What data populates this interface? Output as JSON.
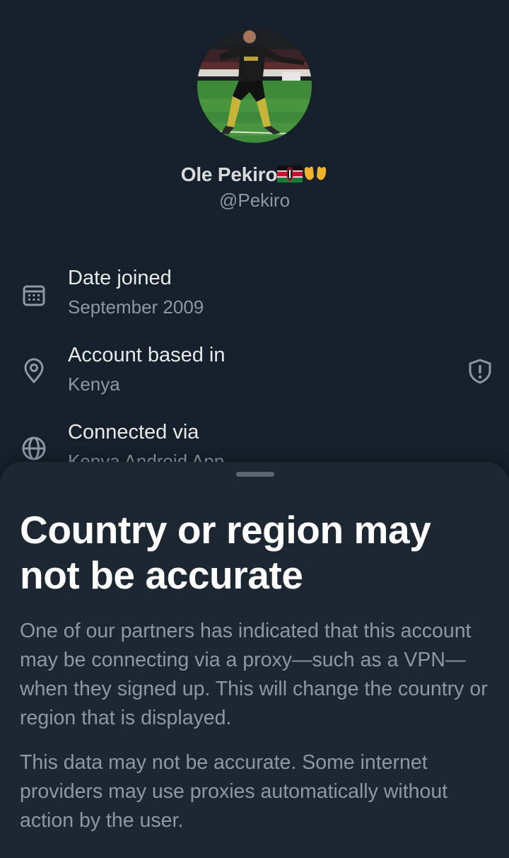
{
  "profile": {
    "display_name": "Ole Pekiro",
    "handle": "@Pekiro"
  },
  "info": {
    "joined": {
      "title": "Date joined",
      "value": "September 2009"
    },
    "location": {
      "title": "Account based in",
      "value": "Kenya"
    },
    "connection": {
      "title": "Connected via",
      "value": "Kenya Android App"
    }
  },
  "sheet": {
    "title": "Country or region may not be accurate",
    "paragraph1": "One of our partners has indicated that this account may be connecting via a proxy—such as a VPN—when they signed up. This will change the country or region that is displayed.",
    "paragraph2": "This data may not be accurate. Some internet providers may use proxies automatically without action by the user."
  },
  "icons": {
    "joined": "calendar-icon",
    "location": "location-pin-icon",
    "connection": "globe-icon",
    "warning": "shield-alert-icon",
    "flag": "kenya-flag-emoji",
    "hands": "open-hands-emoji"
  },
  "colors": {
    "background": "#15202b",
    "sheet": "#1c2732",
    "primary_text": "#e7e9ea",
    "secondary_text": "#8b98a5"
  }
}
